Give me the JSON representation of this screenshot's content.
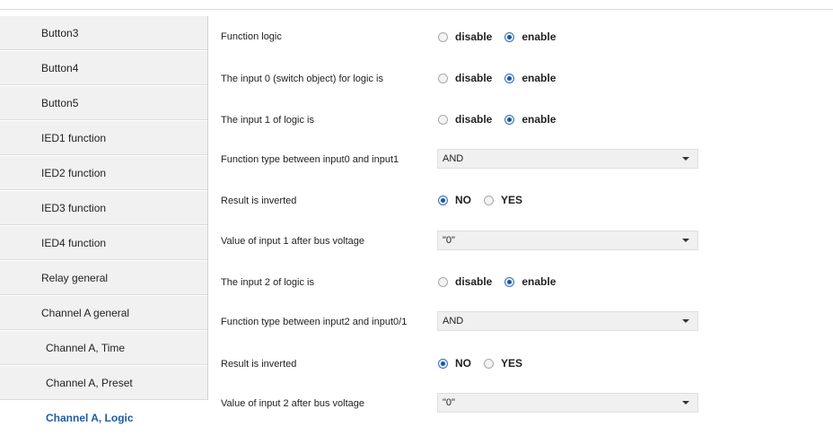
{
  "sidebar": {
    "items": [
      {
        "label": "Button3"
      },
      {
        "label": "Button4"
      },
      {
        "label": "Button5"
      },
      {
        "label": "IED1 function"
      },
      {
        "label": "IED2 function"
      },
      {
        "label": "IED3 function"
      },
      {
        "label": "IED4 function"
      },
      {
        "label": "Relay general"
      },
      {
        "label": "Channel A general"
      },
      {
        "label": "Channel A, Time"
      },
      {
        "label": "Channel A, Preset"
      },
      {
        "label": "Channel A, Logic"
      }
    ],
    "active": "Channel A, Logic"
  },
  "params": {
    "function_logic": {
      "label": "Function logic",
      "opt1": "disable",
      "opt2": "enable",
      "selected": "enable"
    },
    "input0": {
      "label": "The input 0 (switch object) for logic is",
      "opt1": "disable",
      "opt2": "enable",
      "selected": "enable"
    },
    "input1": {
      "label": "The input 1 of logic is",
      "opt1": "disable",
      "opt2": "enable",
      "selected": "enable"
    },
    "func_type_01": {
      "label": "Function type between input0 and input1",
      "value": "AND"
    },
    "result_inverted_1": {
      "label": "Result is inverted",
      "opt1": "NO",
      "opt2": "YES",
      "selected": "NO"
    },
    "value_input1": {
      "label": "Value of input 1 after bus voltage",
      "value": "\"0\""
    },
    "input2": {
      "label": "The input 2 of logic is",
      "opt1": "disable",
      "opt2": "enable",
      "selected": "enable"
    },
    "func_type_2_01": {
      "label": "Function type between input2 and input0/1",
      "value": "AND"
    },
    "result_inverted_2": {
      "label": "Result is inverted",
      "opt1": "NO",
      "opt2": "YES",
      "selected": "NO"
    },
    "value_input2": {
      "label": "Value of input 2 after bus voltage",
      "value": "\"0\""
    }
  }
}
